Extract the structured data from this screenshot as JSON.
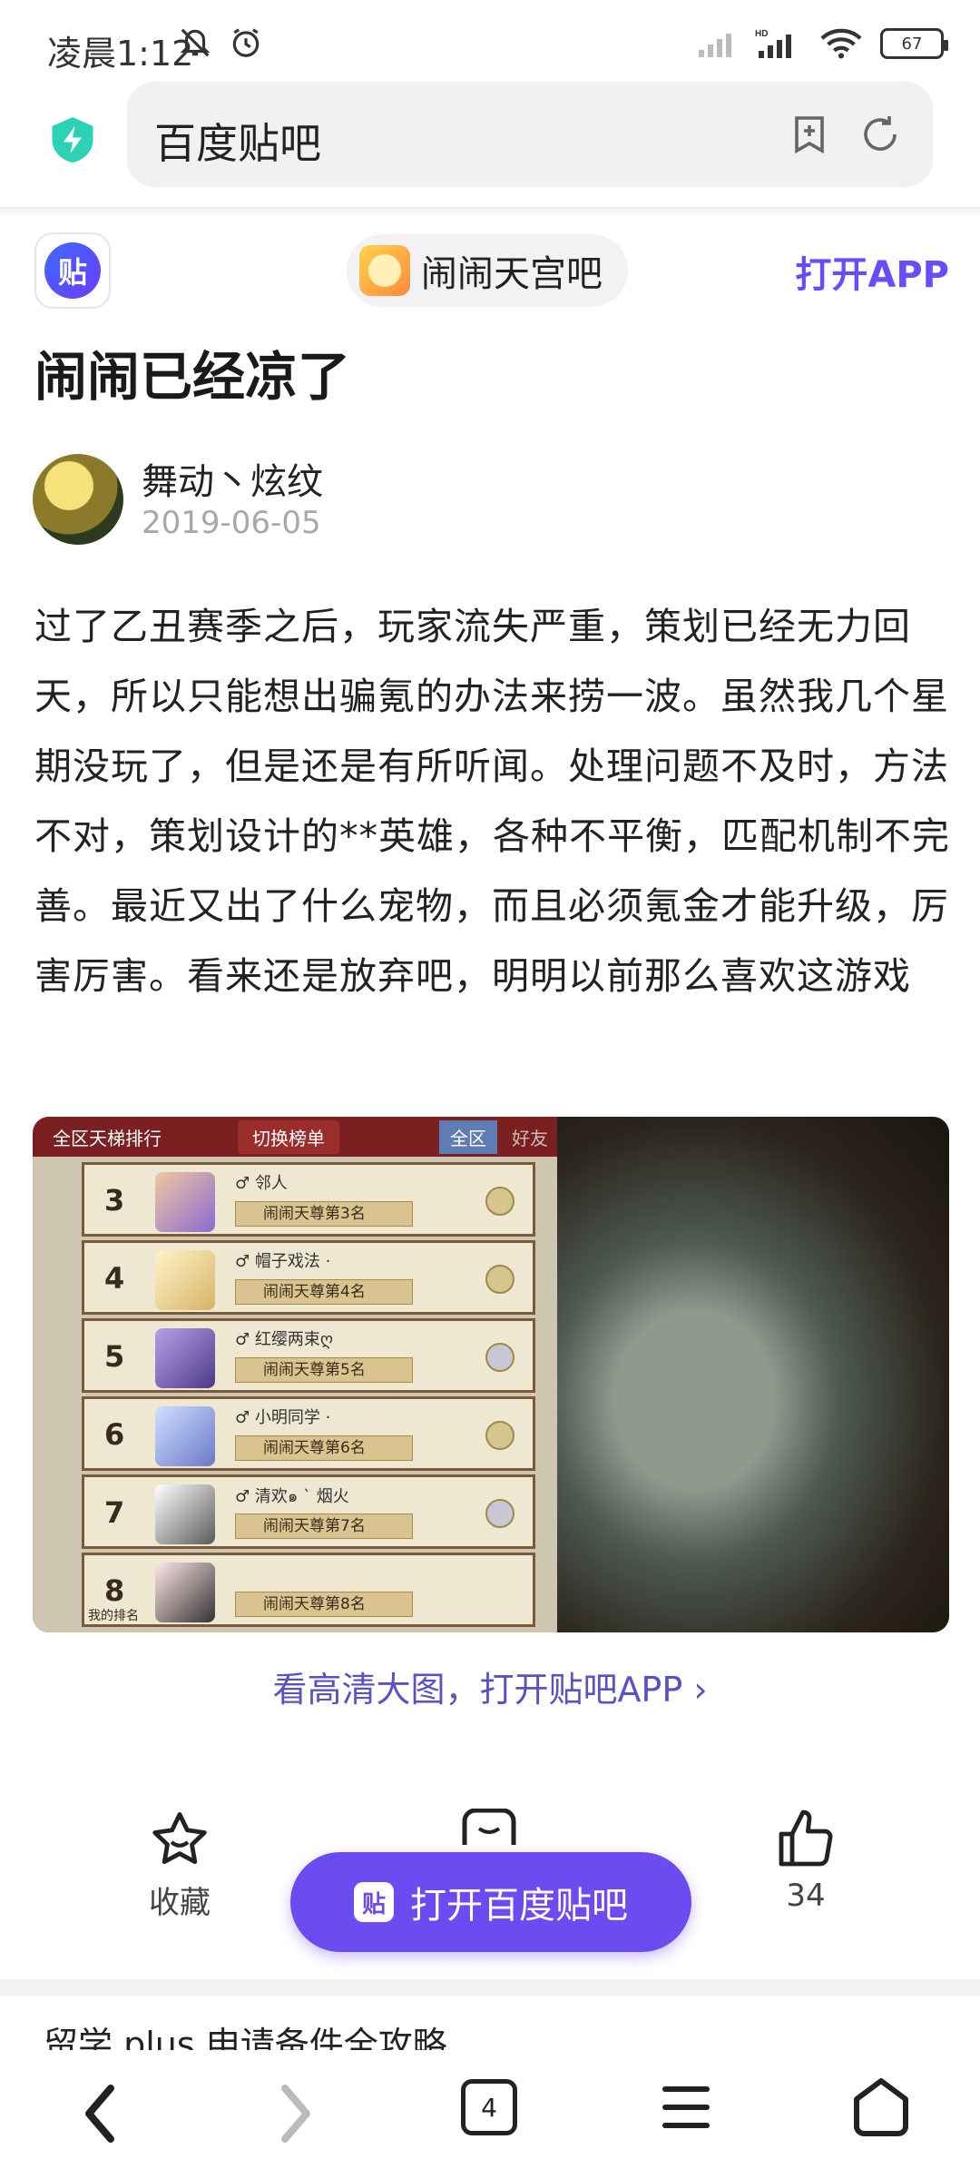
{
  "status_bar": {
    "time": "凌晨1:12",
    "battery": "67",
    "network": "HD"
  },
  "browser": {
    "url_text": "百度贴吧",
    "tab_count": "4"
  },
  "header": {
    "logo_text": "贴",
    "forum_name": "闹闹天宫吧",
    "open_app": "打开APP"
  },
  "post": {
    "title": "闹闹已经凉了",
    "author": "舞动丶炫纹",
    "date": "2019-06-05",
    "body": "过了乙丑赛季之后，玩家流失严重，策划已经无力回天，所以只能想出骗氪的办法来捞一波。虽然我几个星期没玩了，但是还是有所听闻。处理问题不及时，方法不对，策划设计的**英雄，各种不平衡，匹配机制不完善。最近又出了什么宠物，而且必须氪金才能升级，厉害厉害。看来还是放弃吧，明明以前那么喜欢这游戏",
    "hd_link": "看高清大图，打开贴吧APP ›"
  },
  "image": {
    "topbar_title": "全区天梯排行",
    "topbar_switch": "切换榜单",
    "topbar_region": "全区",
    "topbar_friends": "好友",
    "rows": [
      {
        "rank": "3",
        "name": "♂ 邻人",
        "title": "闹闹天尊第3名"
      },
      {
        "rank": "4",
        "name": "♂ 帽子戏法 ·",
        "title": "闹闹天尊第4名"
      },
      {
        "rank": "5",
        "name": "♂ 红缨两束ღ",
        "title": "闹闹天尊第5名"
      },
      {
        "rank": "6",
        "name": "♂ 小明同学 ·",
        "title": "闹闹天尊第6名"
      },
      {
        "rank": "7",
        "name": "♂ 清欢๑ ` 烟火",
        "title": "闹闹天尊第7名"
      },
      {
        "rank": "8",
        "name": "",
        "title": "闹闹天尊第8名",
        "my_rank": "我的排名"
      }
    ]
  },
  "actions": {
    "favorite": "收藏",
    "like_count": "34",
    "open_tieba": "打开百度贴吧",
    "open_tieba_logo": "贴"
  },
  "next_section": {
    "peek_title": "留学 plus 申请备件全攻略"
  },
  "icons": {
    "shield": "shield-lightning-icon",
    "bookmark": "bookmark-add-icon",
    "refresh": "refresh-icon",
    "star": "star-icon",
    "thumb": "thumbs-up-icon",
    "back": "chevron-left-icon",
    "forward": "chevron-right-icon",
    "menu": "menu-icon",
    "home": "home-icon"
  },
  "colors": {
    "accent": "#6c4cf0",
    "link": "#5a52c4",
    "shield": "#2dd2b4"
  }
}
